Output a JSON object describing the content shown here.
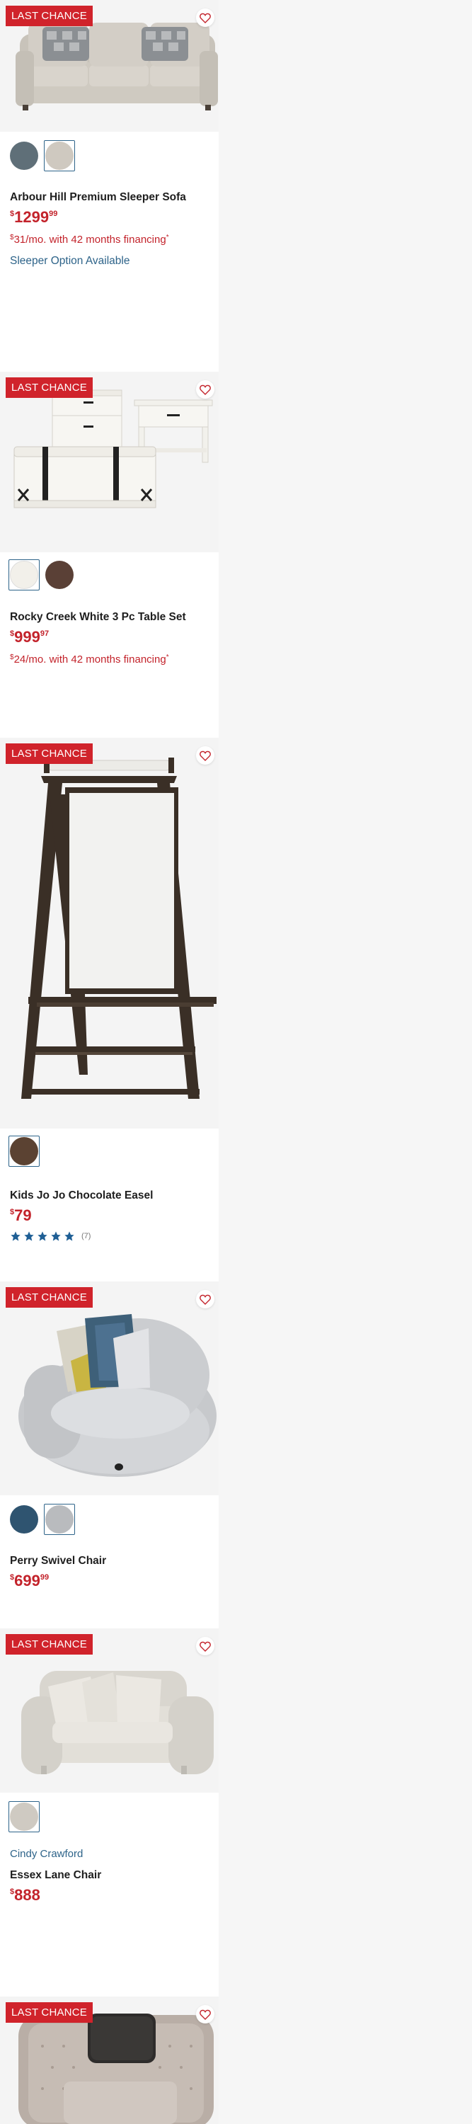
{
  "colors": {
    "accent_red": "#d0232b",
    "price_red": "#c3232b",
    "link_blue": "#2d6389",
    "star_blue": "#1f5f95"
  },
  "products": [
    {
      "badge": "LAST CHANCE",
      "swatches": [
        "#5f6f78",
        "#cfc9c0"
      ],
      "title": "Arbour Hill Premium Sleeper Sofa",
      "price": {
        "currency": "$",
        "dollars": "1299",
        "cents": "99"
      },
      "financing": {
        "currency": "$",
        "text": "31/mo. with 42 months financing",
        "mark": "*"
      },
      "option": "Sleeper Option Available"
    },
    {
      "badge": "LAST CHANCE",
      "swatches": [
        "#f2f0ea",
        "#5a4036"
      ],
      "title": "Rocky Creek White 3 Pc Table Set",
      "price": {
        "currency": "$",
        "dollars": "999",
        "cents": "97"
      },
      "financing": {
        "currency": "$",
        "text": "24/mo. with 42 months financing",
        "mark": "*"
      }
    },
    {
      "badge": "LAST CHANCE",
      "swatches": [
        "#5b4232"
      ],
      "title": "Kids Jo Jo Chocolate Easel",
      "price": {
        "currency": "$",
        "dollars": "79",
        "cents": ""
      },
      "rating": {
        "stars": 5,
        "count": "(7)"
      }
    },
    {
      "badge": "LAST CHANCE",
      "swatches": [
        "#2f5470",
        "#b9bbbe"
      ],
      "title": "Perry Swivel Chair",
      "price": {
        "currency": "$",
        "dollars": "699",
        "cents": "99"
      }
    },
    {
      "badge": "LAST CHANCE",
      "swatches": [
        "#cfcac2"
      ],
      "brand": "Cindy Crawford",
      "title": "Essex Lane Chair",
      "price": {
        "currency": "$",
        "dollars": "888",
        "cents": ""
      }
    },
    {
      "badge": "LAST CHANCE"
    }
  ]
}
